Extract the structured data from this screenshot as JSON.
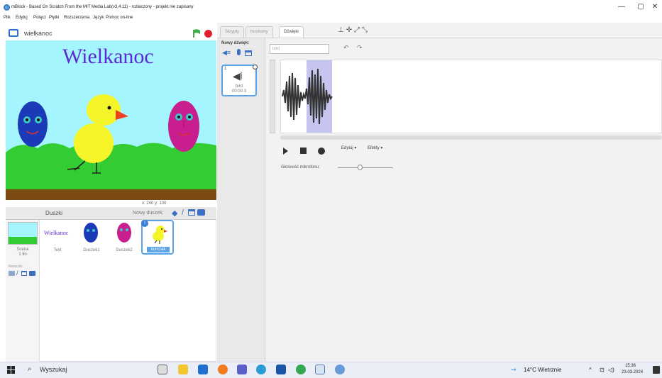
{
  "window": {
    "title": "mBlock - Based On Scratch From the MIT Media Lab(v3.4.11) - rozłaczony - projekt nie zapisany",
    "minimize": "—",
    "maximize": "▢",
    "close": "✕"
  },
  "menu": [
    "Plik",
    "Edytuj",
    "Połącz",
    "Płytki",
    "Rozszerzenia",
    "Język",
    "Pomoc on-line"
  ],
  "stage": {
    "project_name": "wielkanoc",
    "title_text": "Wielkanoc",
    "coords_label": "x: 240  y: 100",
    "colors": {
      "sky": "#a5f5ff",
      "grass": "#33cc33",
      "ground": "#7a4a10",
      "title": "#5a2bd0"
    }
  },
  "sprites": {
    "header_label": "Duszki",
    "new_sprite_label": "Nowy duszek:",
    "scene": {
      "label": "Scena",
      "sub": "1 tło"
    },
    "new_backdrop_label": "Nowe tło:",
    "items": [
      {
        "name": "Text",
        "thumb_text": "Wielkanoc"
      },
      {
        "name": "Duszek1"
      },
      {
        "name": "Duszek2"
      },
      {
        "name": "kurczak"
      }
    ]
  },
  "tabs": [
    "Skrypty",
    "Kostiumy",
    "Dźwięki"
  ],
  "sounds": {
    "new_sound_label": "Nowy dźwięk:",
    "sound_name_value": "bird",
    "card": {
      "index": "1",
      "name": "bird",
      "duration": "00:00.3"
    },
    "edit_menu": "Edytuj",
    "effects_menu": "Efekty",
    "mic_label": "Głośność mikrofonu:",
    "mic_level": 0.4
  },
  "taskbar": {
    "search_placeholder": "Wyszukaj",
    "weather": "14°C Wietrznie",
    "time": "15:36",
    "date": "23.03.2024"
  }
}
